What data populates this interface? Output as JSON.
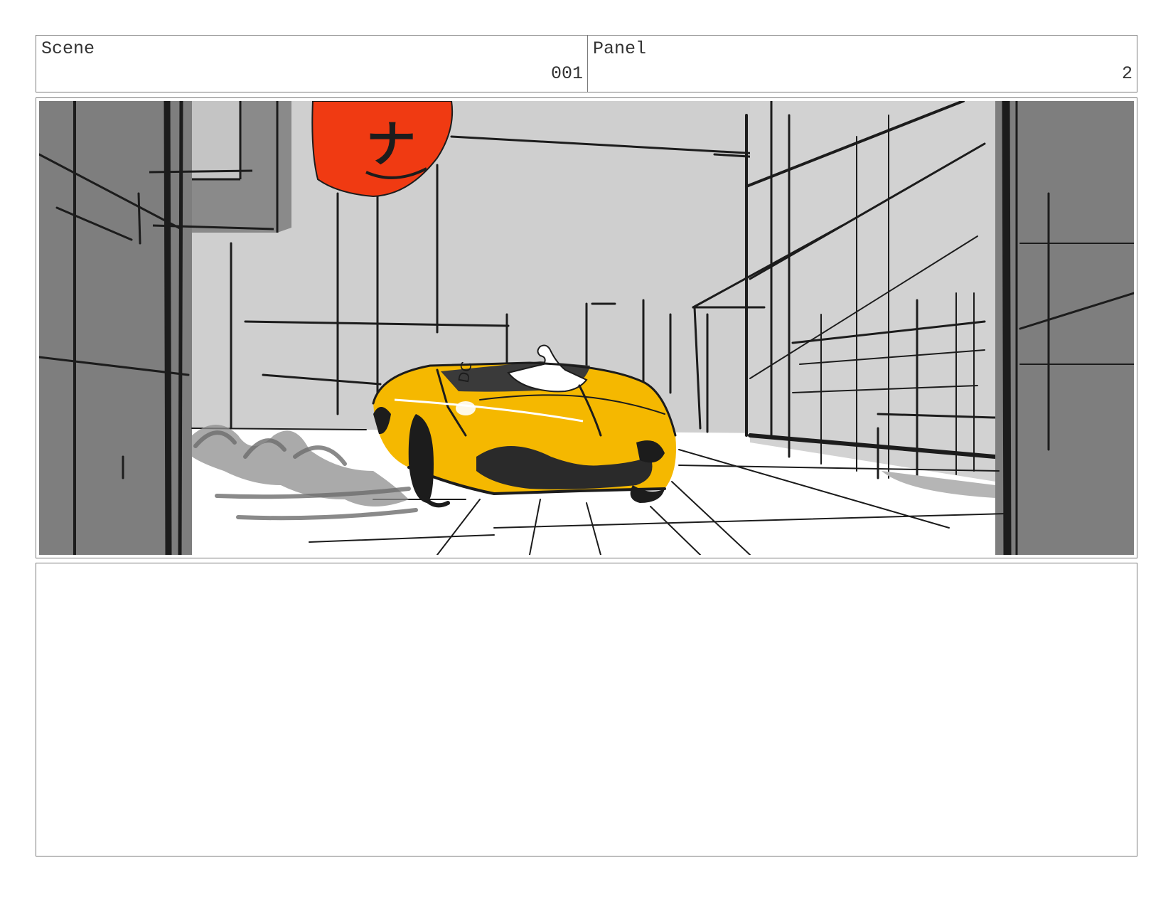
{
  "header": {
    "scene_label": "Scene",
    "scene_value": "001",
    "panel_label": "Panel",
    "panel_value": "2"
  },
  "frame": {
    "sign_text": "ナ",
    "car_text": "DC",
    "colors": {
      "sky": "#cfcfcf",
      "building_dark": "#7e7e7e",
      "car_yellow": "#f5b800",
      "sign_red": "#f03a12",
      "ground": "#ffffff",
      "ink": "#1c1c1c"
    }
  },
  "notes": {
    "text": ""
  }
}
